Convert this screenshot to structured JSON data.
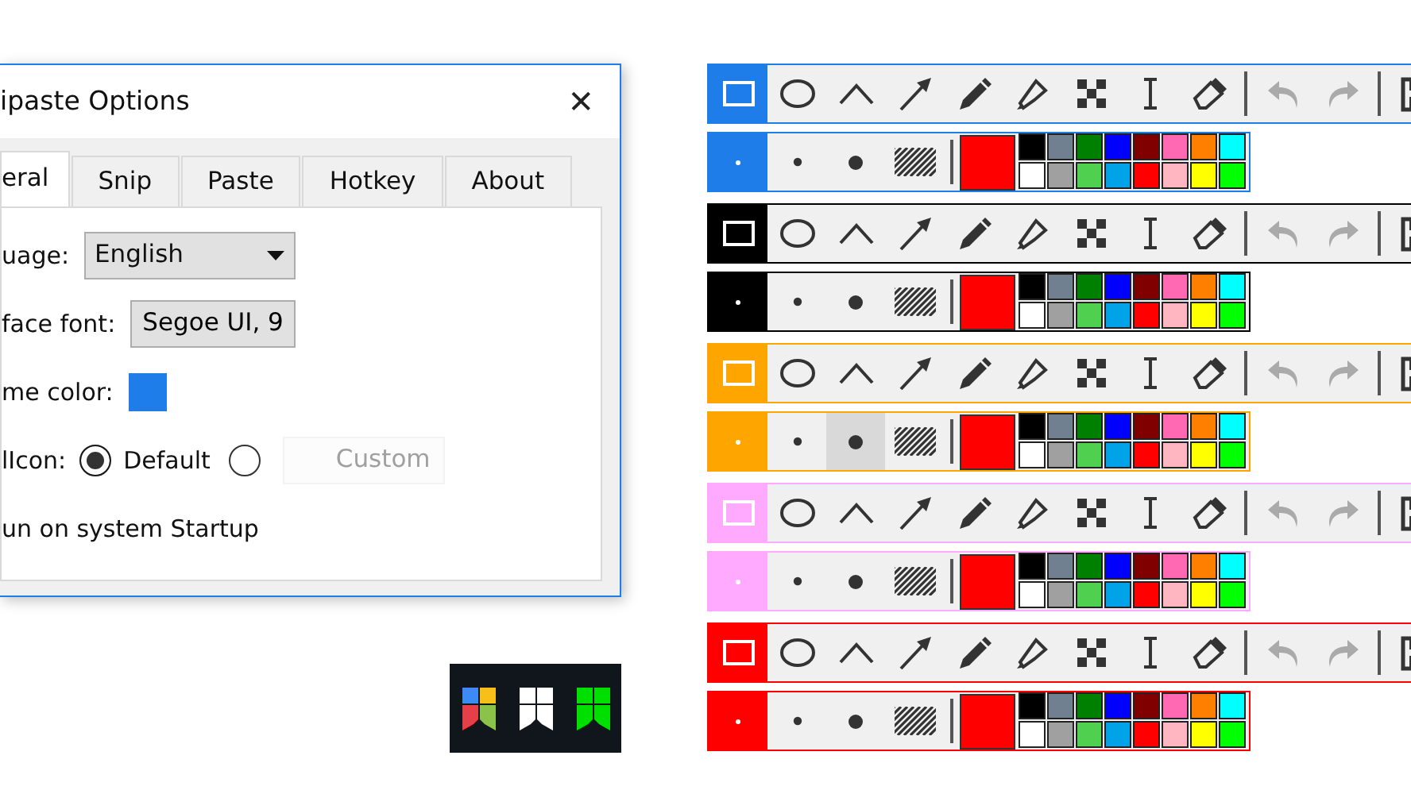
{
  "dialog": {
    "title": "ipaste Options",
    "close": "✕",
    "tabs": [
      {
        "label": "eral",
        "selected": true
      },
      {
        "label": "Snip",
        "selected": false
      },
      {
        "label": "Paste",
        "selected": false
      },
      {
        "label": "Hotkey",
        "selected": false
      },
      {
        "label": "About",
        "selected": false
      }
    ],
    "language": {
      "label": "uage:",
      "value": "English"
    },
    "font": {
      "label": "face font:",
      "value": "Segoe UI, 9"
    },
    "theme_color": {
      "label": "me color:",
      "color": "#1e7de8"
    },
    "tray_icon": {
      "label": "lIcon:",
      "options": [
        {
          "label": "Default",
          "selected": true
        },
        {
          "selected": false
        }
      ],
      "custom_button": {
        "label": "Custom",
        "disabled": true
      }
    },
    "startup": {
      "label": "un on system Startup"
    }
  },
  "toolbars": [
    {
      "color": "#1e7de8",
      "tool_groups": [
        [
          {
            "kind": "rect",
            "selected": true
          },
          {
            "kind": "ellipse",
            "selected": false
          },
          {
            "kind": "polyline",
            "selected": false
          },
          {
            "kind": "arrow",
            "selected": false
          },
          {
            "kind": "pencil",
            "selected": false
          },
          {
            "kind": "marker",
            "selected": false
          },
          {
            "kind": "mosaic",
            "selected": false
          },
          {
            "kind": "text",
            "selected": false
          },
          {
            "kind": "eraser",
            "selected": false
          }
        ],
        [
          {
            "kind": "undo",
            "disabled": true
          },
          {
            "kind": "redo",
            "disabled": true
          }
        ],
        [
          {
            "kind": "save",
            "disabled": false
          }
        ]
      ],
      "sizes": [
        {
          "kind": "small",
          "selected": true,
          "hovered": false
        },
        {
          "kind": "medium",
          "selected": false,
          "hovered": false
        },
        {
          "kind": "large",
          "selected": false,
          "hovered": false
        },
        {
          "kind": "hatch",
          "selected": false,
          "hovered": false
        }
      ],
      "current_color": {
        "color": "#ff0000"
      }
    },
    {
      "color": "#000000",
      "tool_groups": [
        [
          {
            "kind": "rect",
            "selected": true
          },
          {
            "kind": "ellipse",
            "selected": false
          },
          {
            "kind": "polyline",
            "selected": false
          },
          {
            "kind": "arrow",
            "selected": false
          },
          {
            "kind": "pencil",
            "selected": false
          },
          {
            "kind": "marker",
            "selected": false
          },
          {
            "kind": "mosaic",
            "selected": false
          },
          {
            "kind": "text",
            "selected": false
          },
          {
            "kind": "eraser",
            "selected": false
          }
        ],
        [
          {
            "kind": "undo",
            "disabled": true
          },
          {
            "kind": "redo",
            "disabled": true
          }
        ],
        [
          {
            "kind": "save",
            "disabled": false
          }
        ]
      ],
      "sizes": [
        {
          "kind": "small",
          "selected": true,
          "hovered": false
        },
        {
          "kind": "medium",
          "selected": false,
          "hovered": false
        },
        {
          "kind": "large",
          "selected": false,
          "hovered": false
        },
        {
          "kind": "hatch",
          "selected": false,
          "hovered": false
        }
      ],
      "current_color": {
        "color": "#ff0000"
      }
    },
    {
      "color": "#ffa500",
      "tool_groups": [
        [
          {
            "kind": "rect",
            "selected": true
          },
          {
            "kind": "ellipse",
            "selected": false
          },
          {
            "kind": "polyline",
            "selected": false
          },
          {
            "kind": "arrow",
            "selected": false
          },
          {
            "kind": "pencil",
            "selected": false
          },
          {
            "kind": "marker",
            "selected": false
          },
          {
            "kind": "mosaic",
            "selected": false
          },
          {
            "kind": "text",
            "selected": false
          },
          {
            "kind": "eraser",
            "selected": false
          }
        ],
        [
          {
            "kind": "undo",
            "disabled": true
          },
          {
            "kind": "redo",
            "disabled": true
          }
        ],
        [
          {
            "kind": "save",
            "disabled": false
          }
        ]
      ],
      "sizes": [
        {
          "kind": "small",
          "selected": true,
          "hovered": false
        },
        {
          "kind": "medium",
          "selected": false,
          "hovered": false
        },
        {
          "kind": "large",
          "selected": false,
          "hovered": true
        },
        {
          "kind": "hatch",
          "selected": false,
          "hovered": false
        }
      ],
      "current_color": {
        "color": "#ff0000"
      }
    },
    {
      "color": "#ffaaff",
      "tool_groups": [
        [
          {
            "kind": "rect",
            "selected": true
          },
          {
            "kind": "ellipse",
            "selected": false
          },
          {
            "kind": "polyline",
            "selected": false
          },
          {
            "kind": "arrow",
            "selected": false
          },
          {
            "kind": "pencil",
            "selected": false
          },
          {
            "kind": "marker",
            "selected": false
          },
          {
            "kind": "mosaic",
            "selected": false
          },
          {
            "kind": "text",
            "selected": false
          },
          {
            "kind": "eraser",
            "selected": false
          }
        ],
        [
          {
            "kind": "undo",
            "disabled": true
          },
          {
            "kind": "redo",
            "disabled": true
          }
        ],
        [
          {
            "kind": "save",
            "disabled": false
          }
        ]
      ],
      "sizes": [
        {
          "kind": "small",
          "selected": true,
          "hovered": false
        },
        {
          "kind": "medium",
          "selected": false,
          "hovered": false
        },
        {
          "kind": "large",
          "selected": false,
          "hovered": false
        },
        {
          "kind": "hatch",
          "selected": false,
          "hovered": false
        }
      ],
      "current_color": {
        "color": "#ff0000"
      }
    },
    {
      "color": "#ff0000",
      "tool_groups": [
        [
          {
            "kind": "rect",
            "selected": true
          },
          {
            "kind": "ellipse",
            "selected": false
          },
          {
            "kind": "polyline",
            "selected": false
          },
          {
            "kind": "arrow",
            "selected": false
          },
          {
            "kind": "pencil",
            "selected": false
          },
          {
            "kind": "marker",
            "selected": false
          },
          {
            "kind": "mosaic",
            "selected": false
          },
          {
            "kind": "text",
            "selected": false
          },
          {
            "kind": "eraser",
            "selected": false
          }
        ],
        [
          {
            "kind": "undo",
            "disabled": true
          },
          {
            "kind": "redo",
            "disabled": true
          }
        ],
        [
          {
            "kind": "save",
            "disabled": false
          }
        ]
      ],
      "sizes": [
        {
          "kind": "small",
          "selected": true,
          "hovered": false
        },
        {
          "kind": "medium",
          "selected": false,
          "hovered": false
        },
        {
          "kind": "large",
          "selected": false,
          "hovered": false
        },
        {
          "kind": "hatch",
          "selected": false,
          "hovered": false
        }
      ],
      "current_color": {
        "color": "#ff0000"
      }
    }
  ],
  "palette": [
    {
      "color": "#000000"
    },
    {
      "color": "#708090"
    },
    {
      "color": "#008000"
    },
    {
      "color": "#0000ff"
    },
    {
      "color": "#800000"
    },
    {
      "color": "#ff69b4"
    },
    {
      "color": "#ff8000"
    },
    {
      "color": "#00ffff"
    },
    {
      "color": "#ffffff"
    },
    {
      "color": "#a0a0a0"
    },
    {
      "color": "#4fd04f"
    },
    {
      "color": "#00a2e8"
    },
    {
      "color": "#ff0000"
    },
    {
      "color": "#ffb6c1"
    },
    {
      "color": "#ffff00"
    },
    {
      "color": "#00ff00"
    }
  ]
}
